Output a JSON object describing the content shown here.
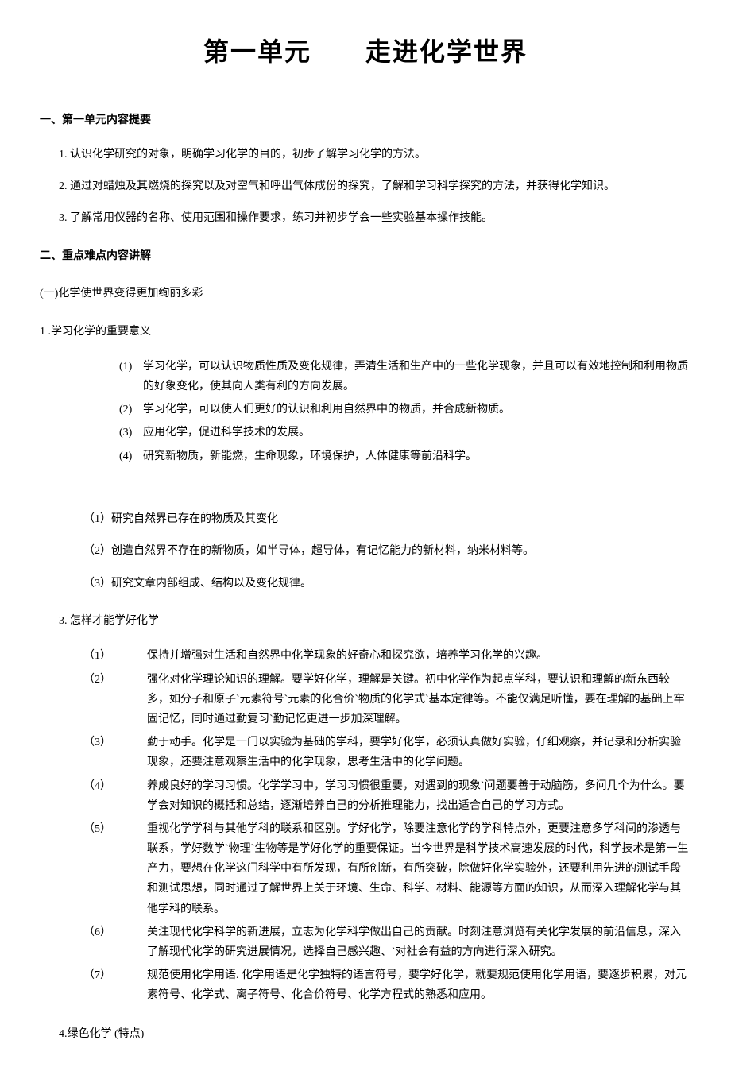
{
  "title": "第一单元　　走进化学世界",
  "s1_heading": "一、第一单元内容提要",
  "s1_p1": "1. 认识化学研究的对象，明确学习化学的目的，初步了解学习化学的方法。",
  "s1_p2": "2. 通过对蜡烛及其燃烧的探究以及对空气和呼出气体成份的探究，了解和学习科学探究的方法，并获得化学知识。",
  "s1_p3": "3. 了解常用仪器的名称、使用范围和操作要求，练习并初步学会一些实验基本操作技能。",
  "s2_heading": "二、重点难点内容讲解",
  "s2_sub1": "(一)化学使世界变得更加绚丽多彩",
  "s2_sub2": "1 .学习化学的重要意义",
  "list1": [
    {
      "n": "(1)",
      "t": "学习化学，可以认识物质性质及变化规律，弄清生活和生产中的一些化学现象，并且可以有效地控制和利用物质的好象变化，使其向人类有利的方向发展。"
    },
    {
      "n": "(2)",
      "t": "学习化学，可以使人们更好的认识和利用自然界中的物质，并合成新物质。"
    },
    {
      "n": "(3)",
      "t": "应用化学，促进科学技术的发展。"
    },
    {
      "n": "(4)",
      "t": "研究新物质，新能燃，生命现象，环境保护，人体健康等前沿科学。"
    }
  ],
  "paren1": "（1）研究自然界已存在的物质及其变化",
  "paren2": "（2）创造自然界不存在的新物质，如半导体，超导体，有记忆能力的新材料，纳米材料等。",
  "paren3": "（3）研究文章内部组成、结构以及变化规律。",
  "item3": "3. 怎样才能学好化学",
  "study": [
    {
      "n": "（1）",
      "t": "保持并增强对生活和自然界中化学现象的好奇心和探究欲，培养学习化学的兴趣。"
    },
    {
      "n": "（2）",
      "t": "强化对化学理论知识的理解。要学好化学，理解是关键。初中化学作为起点学科，要认识和理解的新东西较多，如分子和原子`元素符号`元素的化合价`物质的化学式`基本定律等。不能仅满足听懂，要在理解的基础上牢固记忆，同时通过勤复习`勤记忆更进一步加深理解。"
    },
    {
      "n": "（3）",
      "t": "勤于动手。化学是一门以实验为基础的学科，要学好化学，必须认真做好实验，仔细观察，并记录和分析实验现象，还要注意观察生活中的化学现象，思考生活中的化学问题。"
    },
    {
      "n": "（4）",
      "t": "养成良好的学习习惯。化学学习中，学习习惯很重要，对遇到的现象`问题要善于动脑筋，多问几个为什么。要学会对知识的概括和总结，逐渐培养自己的分析推理能力，找出适合自己的学习方式。"
    },
    {
      "n": "（5）",
      "t": "重视化学学科与其他学科的联系和区别。学好化学，除要注意化学的学科特点外，更要注意多学科间的渗透与联系，学好数学`物理`生物等是学好化学的重要保证。当今世界是科学技术高速发展的时代，科学技术是第一生产力，要想在化学这门科学中有所发现，有所创新，有所突破，除做好化学实验外，还要利用先进的测试手段和测试思想，同时通过了解世界上关于环境、生命、科学、材料、能源等方面的知识，从而深入理解化学与其他学科的联系。"
    },
    {
      "n": "（6）",
      "t": "关注现代化学科学的新进展，立志为化学科学做出自己的贡献。时刻注意浏览有关化学发展的前沿信息，深入了解现代化学的研究进展情况，选择自己感兴趣、`对社会有益的方向进行深入研究。"
    },
    {
      "n": "（7）",
      "t": "规范使用化学用语. 化学用语是化学独特的语言符号，要学好化学，就要规范使用化学用语，要逐步积累，对元素符号、化学式、离子符号、化合价符号、化学方程式的熟悉和应用。"
    }
  ],
  "item4": "4.绿色化学 (特点)"
}
